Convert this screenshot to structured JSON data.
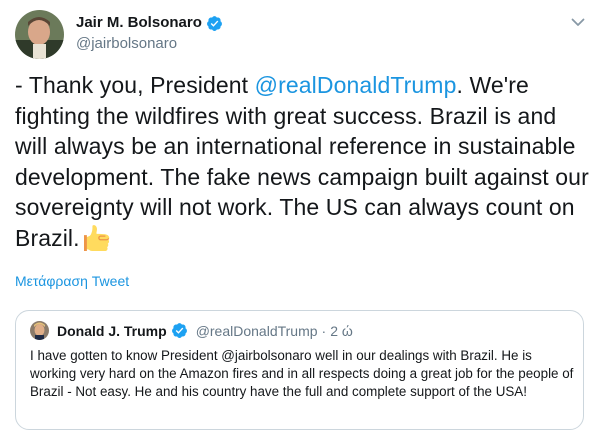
{
  "tweet": {
    "author": {
      "name": "Jair M. Bolsonaro",
      "handle": "@jairbolsonaro"
    },
    "text_before_mention": "- Thank you, President ",
    "mention": "@realDonaldTrump",
    "text_after_mention": ". We're fighting the wildfires with great success. Brazil is and will always be an international reference in sustainable development. The fake news campaign built against our sovereignty will not work. The US can always count on Brazil.",
    "emoji": "thumbs-up-icon",
    "translate_label": "Μετάφραση Tweet"
  },
  "quoted_tweet": {
    "author": {
      "name": "Donald J. Trump",
      "handle": "@realDonaldTrump"
    },
    "separator": "·",
    "time": "2 ώ",
    "text": "I have gotten to know President @jairbolsonaro well in our dealings with Brazil. He is working very hard on the Amazon fires and in all respects doing a great job for the people of Brazil - Not easy. He and his country have the full and complete support of the USA!"
  },
  "colors": {
    "link": "#1b95e0",
    "verified": "#1da1f2",
    "muted": "#657786",
    "border": "#ccd6dd"
  }
}
